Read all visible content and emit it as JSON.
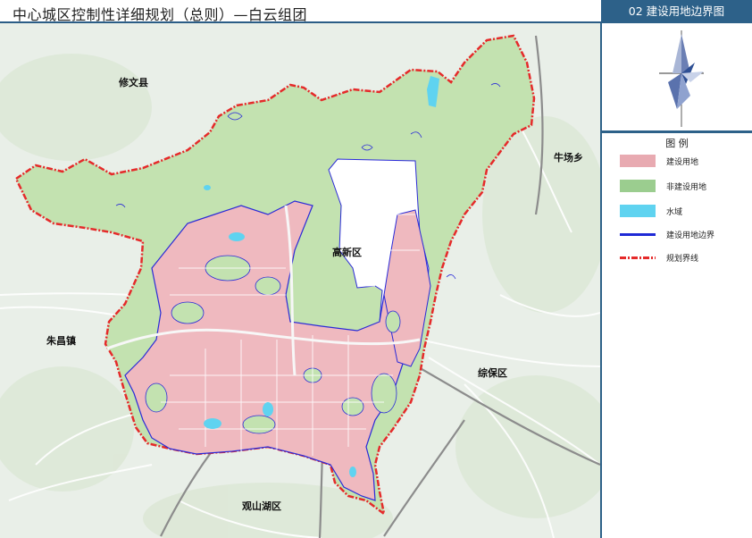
{
  "header": {
    "title": "中心城区控制性详细规划（总则）—白云组团",
    "panel_title": "02 建设用地边界图"
  },
  "legend": {
    "title": "图  例",
    "items": [
      {
        "label": "建设用地",
        "color": "#e8aab1",
        "kind": "fill"
      },
      {
        "label": "非建设用地",
        "color": "#9bcd8f",
        "kind": "fill"
      },
      {
        "label": "水域",
        "color": "#5fd3f0",
        "kind": "fill"
      },
      {
        "label": "建设用地边界",
        "color": "#1f2ad6",
        "kind": "line"
      },
      {
        "label": "规划界线",
        "color": "#e52a2a",
        "kind": "dashline"
      }
    ]
  },
  "map": {
    "places": [
      {
        "name": "修文县"
      },
      {
        "name": "牛场乡"
      },
      {
        "name": "高新区"
      },
      {
        "name": "朱昌镇"
      },
      {
        "name": "综保区"
      },
      {
        "name": "观山湖区"
      }
    ],
    "colors": {
      "construction": "#efb9bf",
      "non_construction": "#c3e2b0",
      "boundary": "#e52a2a",
      "construction_edge": "#2a2ad8",
      "water": "#5fd3f0"
    }
  }
}
